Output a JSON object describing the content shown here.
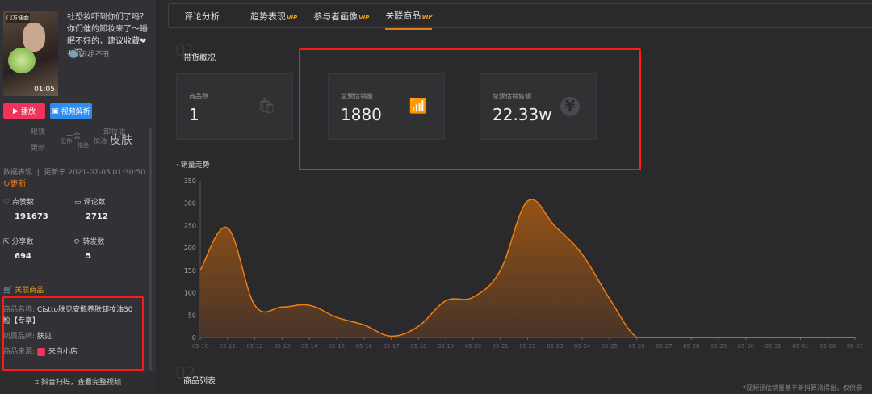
{
  "video": {
    "title": "社恐妆吓到你们了吗？你们催的卸妆来了～睡眠不好的，建议收藏❤ #沉...",
    "author": "丑姐不丑",
    "duration": "01:05",
    "thumb_tag": "门方便面"
  },
  "buttons": {
    "play": "播放",
    "parse": "视频解析"
  },
  "wordcloud": [
    "眼镜",
    "一会",
    "卸妆油",
    "更新",
    "恐怖",
    "推脸",
    "加油",
    "皮肤"
  ],
  "meta": {
    "label": "数据表现",
    "updated": "更新于 2021-07-05 01:30:50",
    "refresh": "更新"
  },
  "stats": [
    {
      "label": "点赞数",
      "value": "191673",
      "icon": "heart-icon"
    },
    {
      "label": "评论数",
      "value": "2712",
      "icon": "comment-icon"
    },
    {
      "label": "分享数",
      "value": "694",
      "icon": "share-icon"
    },
    {
      "label": "转发数",
      "value": "5",
      "icon": "repost-icon"
    }
  ],
  "related": {
    "title": "关联商品",
    "name_label": "商品名称:",
    "name": "Cistto肤见安瓶养肤卸妆油30粒【专享】",
    "brand_label": "所属品牌:",
    "brand": "肤见",
    "source_label": "商品来源:",
    "source": "来自小店"
  },
  "footer": "抖音扫码，查看完整视频",
  "tabs": [
    {
      "label": "评论分析",
      "vip": ""
    },
    {
      "label": "趋势表现",
      "vip": "VIP"
    },
    {
      "label": "参与者画像",
      "vip": "VIP"
    },
    {
      "label": "关联商品",
      "vip": "VIP"
    }
  ],
  "section1": {
    "num": "01",
    "title": "带货概况"
  },
  "cards": [
    {
      "label": "商品数",
      "value": "1",
      "icon": "bag-icon"
    },
    {
      "label": "总预估销量",
      "value": "1880",
      "icon": "bar-trend-icon"
    },
    {
      "label": "总预估销售额",
      "value": "22.33w",
      "icon": "yen-icon"
    }
  ],
  "section2": {
    "num": "02",
    "title": "商品列表"
  },
  "note": "*视频预估销量基于新抖算法得出，仅供参",
  "colors": {
    "accent": "#e07b1a",
    "highlight": "#ff1a1a"
  },
  "chart_data": {
    "type": "area",
    "title": "销量走势",
    "categories": [
      "05-10",
      "05-11",
      "05-12",
      "05-13",
      "05-14",
      "05-15",
      "05-16",
      "05-17",
      "05-18",
      "05-19",
      "05-20",
      "05-21",
      "05-22",
      "05-23",
      "05-24",
      "05-25",
      "05-26",
      "05-27",
      "05-28",
      "05-29",
      "05-30",
      "05-31",
      "06-01",
      "06-06",
      "06-07"
    ],
    "values": [
      150,
      245,
      72,
      68,
      72,
      45,
      28,
      3,
      25,
      82,
      90,
      150,
      305,
      249,
      186,
      87,
      0,
      0,
      0,
      0,
      0,
      0,
      0,
      0,
      0
    ],
    "yticks": [
      0,
      50,
      100,
      150,
      200,
      250,
      300,
      350
    ],
    "ylim": [
      0,
      350
    ],
    "grid": false
  }
}
